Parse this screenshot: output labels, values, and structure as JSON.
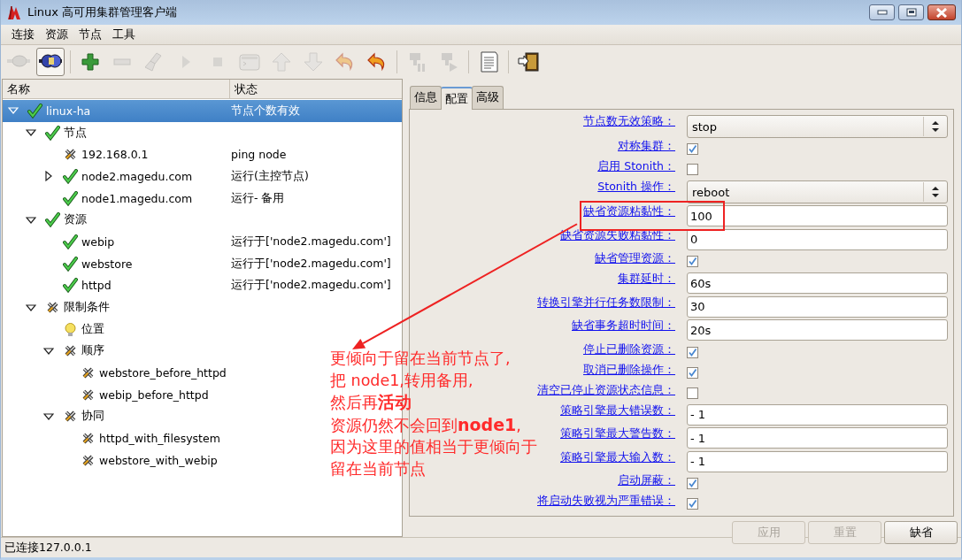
{
  "window": {
    "title": "Linux 高可用集群管理客户端"
  },
  "menu": [
    {
      "label": "连接"
    },
    {
      "label": "资源"
    },
    {
      "label": "节点"
    },
    {
      "label": "工具"
    }
  ],
  "toolbar": [
    [
      {
        "kind": "plug",
        "disabled": true,
        "pressed": false
      },
      {
        "kind": "plug-connected",
        "disabled": false,
        "pressed": true
      }
    ],
    [
      {
        "kind": "plus",
        "disabled": false,
        "pressed": false
      },
      {
        "kind": "minus",
        "disabled": true,
        "pressed": false
      },
      {
        "kind": "broom",
        "disabled": true,
        "pressed": false
      },
      {
        "kind": "play",
        "disabled": true,
        "pressed": false
      },
      {
        "kind": "stop",
        "disabled": true,
        "pressed": false
      },
      {
        "kind": "console",
        "disabled": true,
        "pressed": false
      },
      {
        "kind": "up",
        "disabled": true,
        "pressed": false
      },
      {
        "kind": "down",
        "disabled": true,
        "pressed": false
      },
      {
        "kind": "undo",
        "disabled": true,
        "pressed": false
      },
      {
        "kind": "undo",
        "disabled": false,
        "pressed": false
      }
    ],
    [
      {
        "kind": "server-pause",
        "disabled": true,
        "pressed": false
      },
      {
        "kind": "server-play",
        "disabled": true,
        "pressed": false
      }
    ],
    [
      {
        "kind": "document",
        "disabled": false,
        "pressed": false
      }
    ],
    [
      {
        "kind": "exit",
        "disabled": false,
        "pressed": false
      }
    ]
  ],
  "tree": {
    "columns": [
      "名称",
      "状态"
    ],
    "items": [
      {
        "name": "linux-ha",
        "status": "节点个数有效",
        "kind": "check",
        "selected": true,
        "expanded": true,
        "children": [
          {
            "name": "节点",
            "kind": "check",
            "selected": false,
            "expanded": true,
            "children": [
              {
                "name": "192.168.0.1",
                "status": "ping node",
                "kind": "tools",
                "selected": false
              },
              {
                "name": "node2.magedu.com",
                "status": "运行(主控节点)",
                "kind": "check",
                "selected": false,
                "expanded": false
              },
              {
                "name": "node1.magedu.com",
                "status": "运行- 备用",
                "kind": "check",
                "selected": false
              }
            ]
          },
          {
            "name": "资源",
            "kind": "check",
            "selected": false,
            "expanded": true,
            "children": [
              {
                "name": "webip",
                "status": "运行于['node2.magedu.com']",
                "kind": "check",
                "selected": false
              },
              {
                "name": "webstore",
                "status": "运行于['node2.magedu.com']",
                "kind": "check",
                "selected": false
              },
              {
                "name": "httpd",
                "status": "运行于['node2.magedu.com']",
                "kind": "check",
                "selected": false
              }
            ]
          },
          {
            "name": "限制条件",
            "kind": "tools",
            "selected": false,
            "expanded": true,
            "children": [
              {
                "name": "位置",
                "kind": "bulb",
                "selected": false
              },
              {
                "name": "顺序",
                "kind": "tools",
                "selected": false,
                "expanded": true,
                "children": [
                  {
                    "name": "webstore_before_httpd",
                    "kind": "tools",
                    "selected": false
                  },
                  {
                    "name": "webip_before_httpd",
                    "kind": "tools",
                    "selected": false
                  }
                ]
              },
              {
                "name": "协同",
                "kind": "tools",
                "selected": false,
                "expanded": true,
                "children": [
                  {
                    "name": "httpd_with_filesystem",
                    "kind": "tools",
                    "selected": false
                  },
                  {
                    "name": "webstore_with_webip",
                    "kind": "tools",
                    "selected": false
                  }
                ]
              }
            ]
          }
        ]
      }
    ]
  },
  "tabs": [
    {
      "label": "信息",
      "selected": false
    },
    {
      "label": "配置",
      "selected": true
    },
    {
      "label": "高级",
      "selected": false
    }
  ],
  "fields": [
    {
      "kind": "select",
      "label": "节点数无效策略：",
      "value": "stop"
    },
    {
      "kind": "checkbox",
      "label": "对称集群：",
      "checked": true
    },
    {
      "kind": "checkbox",
      "label": "启用 Stonith：",
      "checked": false
    },
    {
      "kind": "select",
      "label": "Stonith 操作：",
      "value": "reboot"
    },
    {
      "kind": "input",
      "label": "缺省资源粘黏性：",
      "value": "100",
      "highlighted": true
    },
    {
      "kind": "input",
      "label": "缺省资源失败粘黏性：",
      "value": "0"
    },
    {
      "kind": "checkbox",
      "label": "缺省管理资源：",
      "checked": true
    },
    {
      "kind": "input",
      "label": "集群延时：",
      "value": "60s"
    },
    {
      "kind": "input",
      "label": "转换引擎并行任务数限制：",
      "value": "30"
    },
    {
      "kind": "input",
      "label": "缺省事务超时时间：",
      "value": "20s"
    },
    {
      "kind": "checkbox",
      "label": "停止已删除资源：",
      "checked": true
    },
    {
      "kind": "checkbox",
      "label": "取消已删除操作：",
      "checked": true
    },
    {
      "kind": "checkbox",
      "label": "清空已停止资源状态信息：",
      "checked": false
    },
    {
      "kind": "input",
      "label": "策略引擎最大错误数：",
      "value": "- 1"
    },
    {
      "kind": "input",
      "label": "策略引擎最大警告数：",
      "value": "- 1"
    },
    {
      "kind": "input",
      "label": "策略引擎最大输入数：",
      "value": "- 1"
    },
    {
      "kind": "checkbox",
      "label": "启动屏蔽：",
      "checked": true
    },
    {
      "kind": "checkbox",
      "label": "将启动失败视为严重错误：",
      "checked": true
    }
  ],
  "buttons": [
    {
      "label": "应用",
      "disabled": true
    },
    {
      "label": "重置",
      "disabled": true
    },
    {
      "label": "缺省",
      "disabled": false
    }
  ],
  "annotation": {
    "lines": [
      "更倾向于留在当前节点了,",
      "把 node1,转用备用,",
      "然后再**活动**",
      "资源仍然不会回到**node1**,",
      "因为这里的值相当于更倾向于",
      "留在当前节点"
    ]
  },
  "status_bar": "已连接127.0.0.1"
}
